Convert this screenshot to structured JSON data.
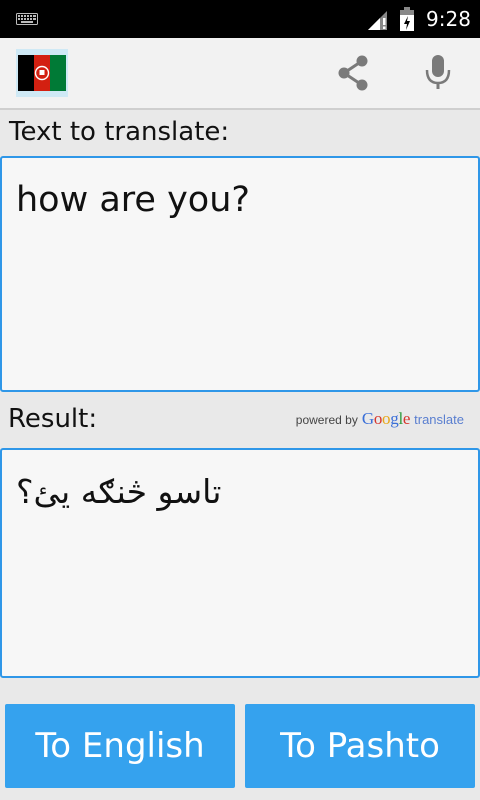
{
  "status_bar": {
    "time": "9:28",
    "icons": [
      "keyboard-icon",
      "signal-icon",
      "battery-icon"
    ]
  },
  "action_bar": {
    "icons": [
      "afghanistan-flag-icon",
      "share-icon",
      "microphone-icon"
    ]
  },
  "source": {
    "label": "Text to translate:",
    "text": "how are you?"
  },
  "result": {
    "label": "Result:",
    "text": "تاسو څنګه یئ؟"
  },
  "powered_by": {
    "prefix": "powered by",
    "google": [
      "G",
      "o",
      "o",
      "g",
      "l",
      "e"
    ],
    "suffix": "translate"
  },
  "buttons": {
    "to_english": "To English",
    "to_pashto": "To Pashto"
  },
  "colors": {
    "accent": "#35a2ee",
    "border": "#2f97e8",
    "flag_black": "#000000",
    "flag_red": "#d32011",
    "flag_green": "#007a36"
  }
}
